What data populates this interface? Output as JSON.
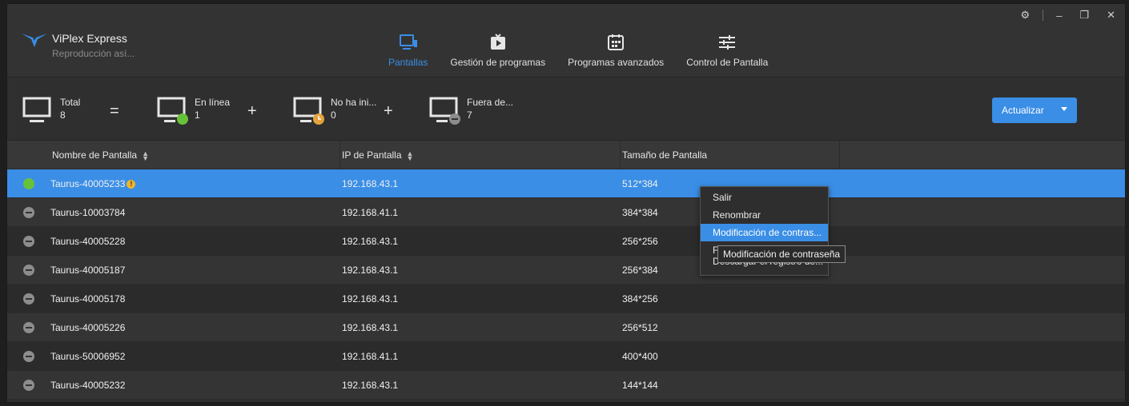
{
  "app": {
    "title": "ViPlex Express",
    "subtitle": "Reproducción así..."
  },
  "window_controls": {
    "settings": "⚙",
    "minimize": "–",
    "restore": "❐",
    "close": "✕"
  },
  "nav": {
    "tabs": [
      {
        "label": "Pantallas",
        "icon": "screen-icon",
        "active": true
      },
      {
        "label": "Gestión de programas",
        "icon": "play-icon",
        "active": false
      },
      {
        "label": "Programas avanzados",
        "icon": "calendar-icon",
        "active": false
      },
      {
        "label": "Control de Pantalla",
        "icon": "sliders-icon",
        "active": false
      }
    ]
  },
  "summary": {
    "total": {
      "label": "Total",
      "value": "8"
    },
    "online": {
      "label": "En línea",
      "value": "1"
    },
    "not_started": {
      "label": "No ha ini...",
      "value": "0"
    },
    "offline": {
      "label": "Fuera de...",
      "value": "7"
    },
    "equals": "=",
    "plus": "+"
  },
  "refresh_button": {
    "label": "Actualizar"
  },
  "table": {
    "columns": [
      "Nombre de Pantalla",
      "IP de Pantalla",
      "Tamaño de Pantalla"
    ],
    "rows": [
      {
        "name": "Taurus-40005233",
        "ip": "192.168.43.1",
        "size": "512*384",
        "status": "online",
        "warning": true
      },
      {
        "name": "Taurus-10003784",
        "ip": "192.168.41.1",
        "size": "384*384",
        "status": "offline"
      },
      {
        "name": "Taurus-40005228",
        "ip": "192.168.43.1",
        "size": "256*256",
        "status": "offline"
      },
      {
        "name": "Taurus-40005187",
        "ip": "192.168.43.1",
        "size": "256*384",
        "status": "offline"
      },
      {
        "name": "Taurus-40005178",
        "ip": "192.168.43.1",
        "size": "384*256",
        "status": "offline"
      },
      {
        "name": "Taurus-40005226",
        "ip": "192.168.43.1",
        "size": "256*512",
        "status": "offline"
      },
      {
        "name": "Taurus-50006952",
        "ip": "192.168.41.1",
        "size": "400*400",
        "status": "offline"
      },
      {
        "name": "Taurus-40005232",
        "ip": "192.168.43.1",
        "size": "144*144",
        "status": "offline"
      }
    ]
  },
  "context_menu": {
    "items": [
      "Salir",
      "Renombrar",
      "Modificación de contras...",
      "F",
      "Descargar el registro de..."
    ],
    "highlighted_index": 2
  },
  "tooltip": "Modificación de contraseña",
  "colors": {
    "accent": "#3a8ee6",
    "online": "#67c23a",
    "not_started": "#e6a23c",
    "offline": "#8d8d8d"
  }
}
